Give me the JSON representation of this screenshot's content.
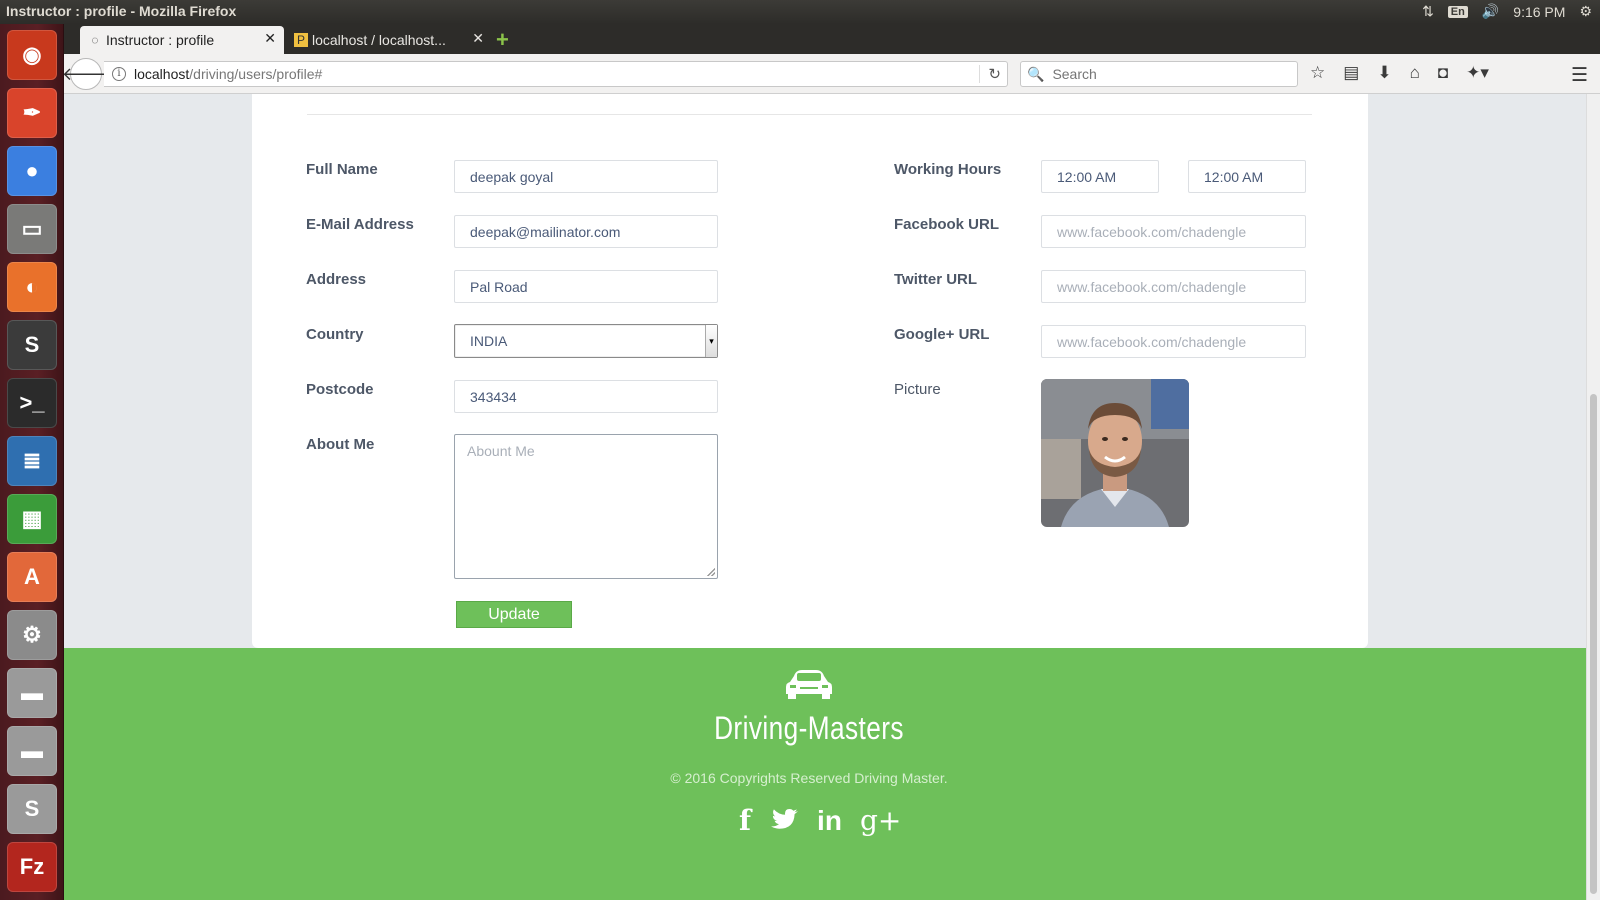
{
  "os": {
    "window_title": "Instructor : profile - Mozilla Firefox",
    "lang": "En",
    "clock": "9:16 PM",
    "launcher": [
      {
        "name": "ubuntu-dash-icon",
        "glyph": "◉",
        "bg": "#c8391d"
      },
      {
        "name": "inkscape-icon",
        "glyph": "✒",
        "bg": "#d9442b"
      },
      {
        "name": "chrome-icon",
        "glyph": "●",
        "bg": "#3b7fe0"
      },
      {
        "name": "files-icon",
        "glyph": "▭",
        "bg": "#7a7a78"
      },
      {
        "name": "firefox-icon",
        "glyph": "◐",
        "bg": "#e9712b"
      },
      {
        "name": "sublime-icon",
        "glyph": "S",
        "bg": "#3b3b3b"
      },
      {
        "name": "terminal-icon",
        "glyph": ">_",
        "bg": "#2b2b2b"
      },
      {
        "name": "writer-icon",
        "glyph": "≣",
        "bg": "#2f6fb0"
      },
      {
        "name": "calc-icon",
        "glyph": "▦",
        "bg": "#3b9c3a"
      },
      {
        "name": "software-center-icon",
        "glyph": "A",
        "bg": "#e2683a"
      },
      {
        "name": "settings-icon",
        "glyph": "⚙",
        "bg": "#8b8b8b"
      },
      {
        "name": "drive-icon",
        "glyph": "▬",
        "bg": "#9a9a9a"
      },
      {
        "name": "drive-icon-2",
        "glyph": "▬",
        "bg": "#9a9a9a"
      },
      {
        "name": "skype-icon",
        "glyph": "S",
        "bg": "#9a9a9a"
      },
      {
        "name": "filezilla-icon",
        "glyph": "Fz",
        "bg": "#b3261e"
      }
    ]
  },
  "browser": {
    "tabs": [
      {
        "title": "Instructor : profile",
        "active": true
      },
      {
        "title": "localhost / localhost...",
        "active": false
      }
    ],
    "url_host": "localhost",
    "url_path": "/driving/users/profile#",
    "search_placeholder": "Search"
  },
  "form": {
    "left": {
      "full_name": {
        "label": "Full Name",
        "value": "deepak goyal"
      },
      "email": {
        "label": "E-Mail Address",
        "value": "deepak@mailinator.com"
      },
      "address": {
        "label": "Address",
        "value": "Pal Road"
      },
      "country": {
        "label": "Country",
        "value": "INDIA"
      },
      "postcode": {
        "label": "Postcode",
        "value": "343434"
      },
      "about": {
        "label": "About Me",
        "placeholder": "Abount Me"
      }
    },
    "right": {
      "working_hours": {
        "label": "Working Hours",
        "from": "12:00 AM",
        "to": "12:00 AM"
      },
      "facebook": {
        "label": "Facebook URL",
        "placeholder": "www.facebook.com/chadengle"
      },
      "twitter": {
        "label": "Twitter URL",
        "placeholder": "www.facebook.com/chadengle"
      },
      "google": {
        "label": "Google+ URL",
        "placeholder": "www.facebook.com/chadengle"
      },
      "picture": {
        "label": "Picture"
      }
    },
    "update_label": "Update"
  },
  "footer": {
    "brand": "Driving-Masters",
    "copyright": "© 2016 Copyrights Reserved Driving Master.",
    "social": [
      {
        "name": "facebook-icon",
        "glyph": "f"
      },
      {
        "name": "twitter-icon",
        "glyph": "🐦"
      },
      {
        "name": "linkedin-icon",
        "glyph": "in"
      },
      {
        "name": "googleplus-icon",
        "glyph": "g+"
      }
    ]
  },
  "colors": {
    "accent_green": "#6ec05a",
    "label_text": "#4d5767",
    "field_text": "#4a5a78"
  }
}
